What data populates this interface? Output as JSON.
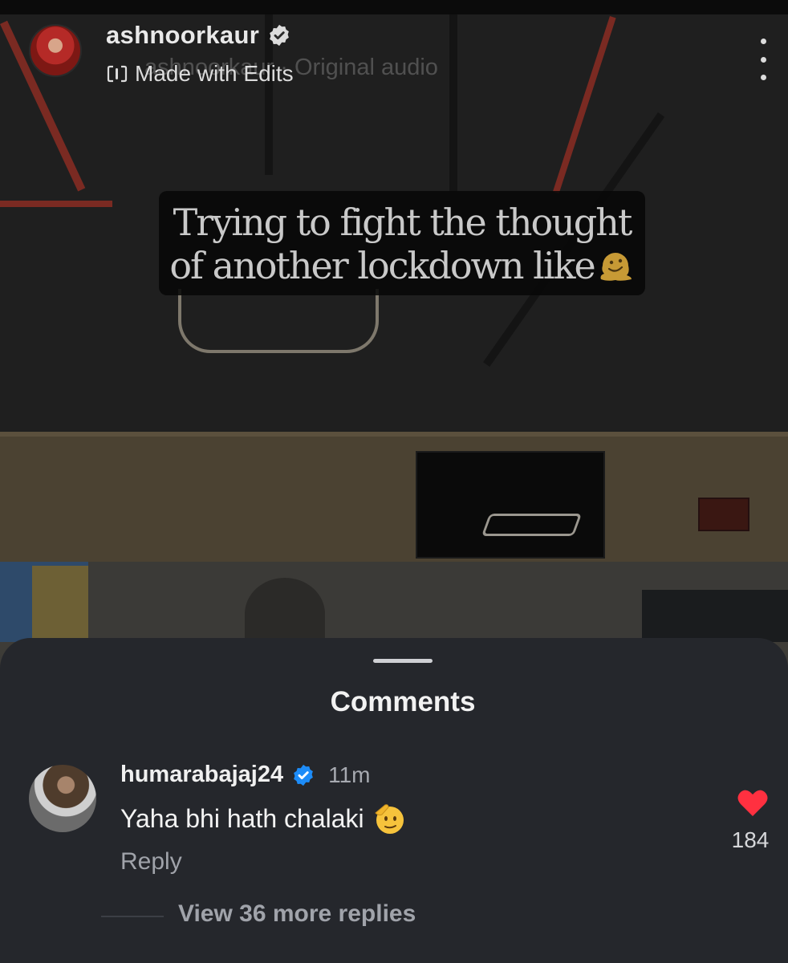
{
  "post": {
    "username": "ashnoorkaur",
    "verified_icon": "verified-badge-icon",
    "audio_text": "ashnoorkaur · Original audio",
    "edits_label": "Made with Edits",
    "more_icon": "more-vertical-icon"
  },
  "caption": {
    "line1": "Trying to fight the thought",
    "line2": "of another lockdown like",
    "emoji": "melting-face-emoji"
  },
  "comments_sheet": {
    "title": "Comments",
    "comment": {
      "username": "humarabajaj24",
      "verified": true,
      "time": "11m",
      "text": "Yaha bhi hath chalaki",
      "emoji": "saluting-face-emoji",
      "reply_label": "Reply",
      "likes": "184",
      "like_color": "#ff3040"
    },
    "view_replies": "View 36 more replies"
  },
  "colors": {
    "sheet_bg": "#25272c",
    "verified_blue": "#1d8cf8",
    "muted_text": "#a0a3aa"
  }
}
